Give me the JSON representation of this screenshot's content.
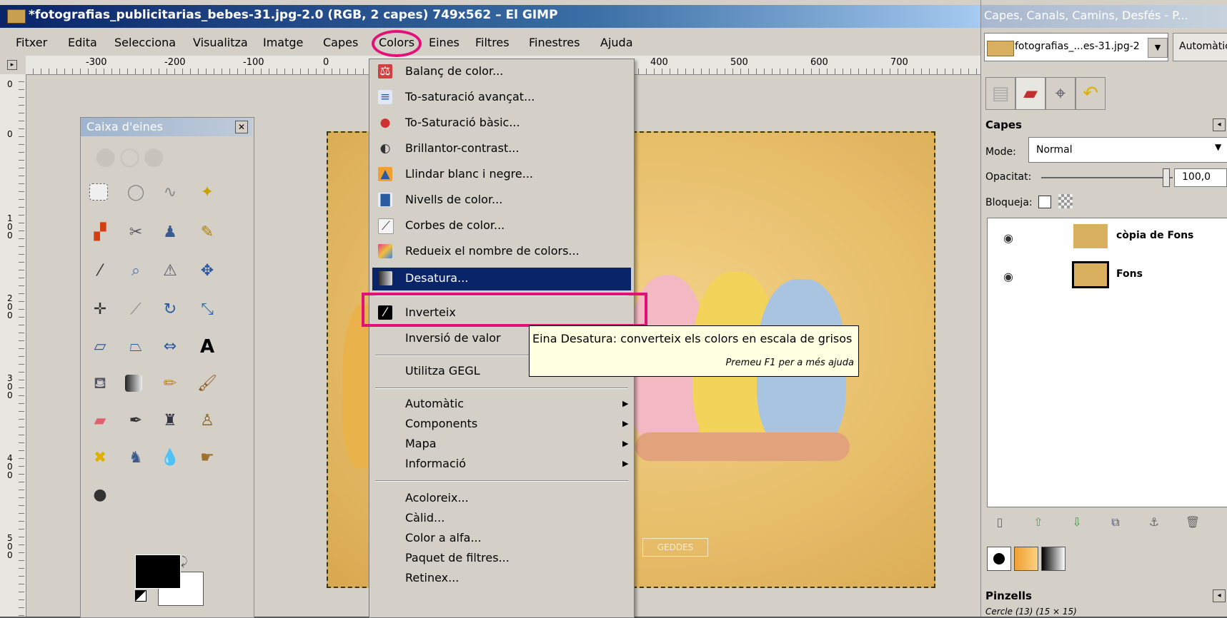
{
  "window": {
    "title": "*fotografias_publicitarias_bebes-31.jpg-2.0 (RGB, 2 capes) 749x562 – El GIMP"
  },
  "menu_bar": [
    "Fitxer",
    "Edita",
    "Selecciona",
    "Visualitza",
    "Imatge",
    "Capes",
    "Colors",
    "Eines",
    "Filtres",
    "Finestres",
    "Ajuda"
  ],
  "ruler": {
    "h_ticks": [
      "-300",
      "-200",
      "-100",
      "0",
      "400",
      "500",
      "600",
      "700"
    ],
    "v_ticks": [
      "0",
      "100",
      "200",
      "300",
      "400",
      "500"
    ]
  },
  "toolbox": {
    "title": "Caixa d'eines",
    "close_label": "✕"
  },
  "colors_menu": {
    "items": [
      {
        "label": "Balanç de color...",
        "icon": "color-balance-icon"
      },
      {
        "label": "To-saturació avançat...",
        "icon": "hue-saturation-icon"
      },
      {
        "label": "To-Saturació bàsic...",
        "icon": "colorize-icon"
      },
      {
        "label": "Brillantor-contrast...",
        "icon": "brightness-contrast-icon"
      },
      {
        "label": "Llindar blanc i negre...",
        "icon": "threshold-icon"
      },
      {
        "label": "Nivells de color...",
        "icon": "levels-icon"
      },
      {
        "label": "Corbes de color...",
        "icon": "curves-icon"
      },
      {
        "label": "Redueix el nombre de colors...",
        "icon": "posterize-icon"
      },
      {
        "label": "Desatura...",
        "icon": "desaturate-icon"
      },
      {
        "label": "Inverteix",
        "icon": "invert-icon"
      },
      {
        "label": "Inversió de valor",
        "icon": ""
      },
      {
        "label": "Utilitza GEGL",
        "icon": ""
      },
      {
        "label": "Automàtic",
        "submenu": true
      },
      {
        "label": "Components",
        "submenu": true
      },
      {
        "label": "Mapa",
        "submenu": true
      },
      {
        "label": "Informació",
        "submenu": true
      },
      {
        "label": "Acoloreix..."
      },
      {
        "label": "Càlid..."
      },
      {
        "label": "Color a alfa..."
      },
      {
        "label": "Paquet de filtres..."
      },
      {
        "label": "Retinex..."
      }
    ],
    "highlighted": "Desatura..."
  },
  "tooltip": {
    "main": "Eina Desatura: converteix els colors en escala de grisos",
    "help": "Premeu F1 per a més ajuda"
  },
  "dock": {
    "title": "Capes, Canals, Camins, Desfés - P...",
    "image_select": "fotografias_...es-31.jpg-2",
    "auto_button": "Automàtic",
    "layers_heading": "Capes",
    "mode_label": "Mode:",
    "mode_value": "Normal",
    "opacity_label": "Opacitat:",
    "opacity_value": "100,0",
    "opacity_level": 1.0,
    "lock_label": "Bloqueja:",
    "layers": [
      {
        "name": "còpia de Fons",
        "active": false
      },
      {
        "name": "Fons",
        "active": true
      }
    ],
    "brushes_heading": "Pinzells",
    "brush_info": "Cercle (13) (15 × 15)"
  },
  "colors": {
    "highlight_ring": "#e2117a",
    "menu_selected": "#0a246a",
    "tooltip_bg": "#ffffe1"
  }
}
